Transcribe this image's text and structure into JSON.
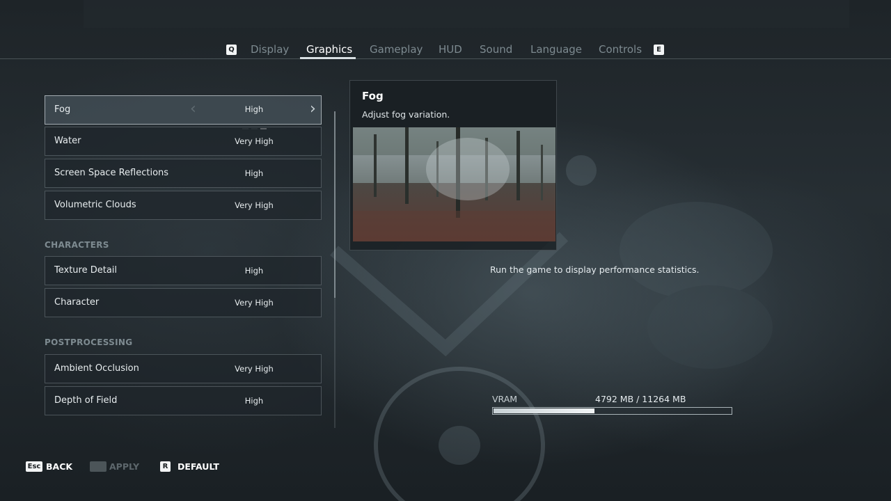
{
  "tabs": {
    "prev_key": "Q",
    "next_key": "E",
    "items": [
      {
        "label": "Display",
        "active": false
      },
      {
        "label": "Graphics",
        "active": true
      },
      {
        "label": "Gameplay",
        "active": false
      },
      {
        "label": "HUD",
        "active": false
      },
      {
        "label": "Sound",
        "active": false
      },
      {
        "label": "Language",
        "active": false
      },
      {
        "label": "Controls",
        "active": false
      }
    ]
  },
  "settings": {
    "environment": [
      {
        "label": "Fog",
        "value": "High"
      },
      {
        "label": "Water",
        "value": "Very High"
      },
      {
        "label": "Screen Space Reflections",
        "value": "High"
      },
      {
        "label": "Volumetric Clouds",
        "value": "Very High"
      }
    ],
    "characters_header": "CHARACTERS",
    "characters": [
      {
        "label": "Texture Detail",
        "value": "High"
      },
      {
        "label": "Character",
        "value": "Very High"
      }
    ],
    "postprocessing_header": "POSTPROCESSING",
    "postprocessing": [
      {
        "label": "Ambient Occlusion",
        "value": "Very High"
      },
      {
        "label": "Depth of Field",
        "value": "High"
      }
    ]
  },
  "info_panel": {
    "title": "Fog",
    "description": "Adjust fog variation."
  },
  "performance": {
    "message": "Run the game to display performance statistics."
  },
  "vram": {
    "label": "VRAM",
    "value_text": "4792 MB / 11264 MB",
    "used_fraction": 0.4254
  },
  "footer": {
    "back_key": "Esc",
    "back_label": "BACK",
    "apply_label": "APPLY",
    "default_key": "R",
    "default_label": "DEFAULT"
  },
  "colors": {
    "accent": "#ffffff",
    "inactive_text": "#7d8a90",
    "panel_bg": "#1e262b"
  }
}
